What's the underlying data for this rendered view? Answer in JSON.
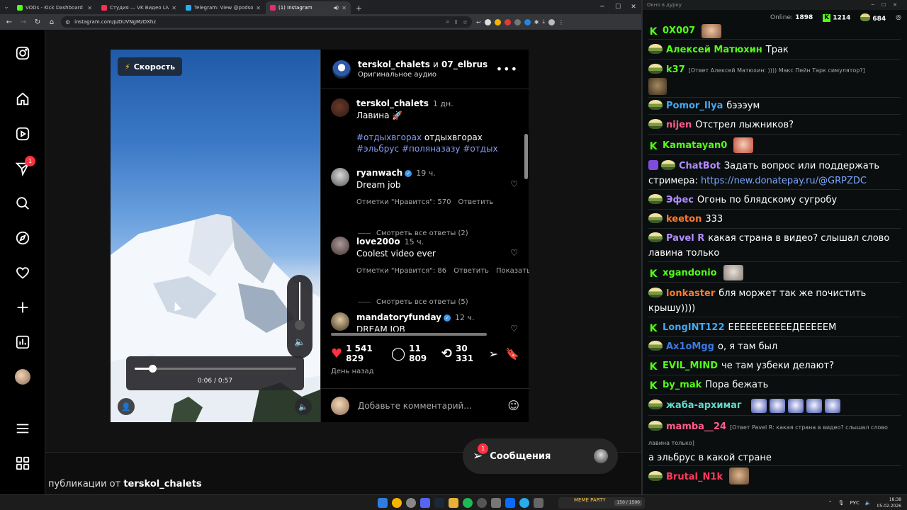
{
  "browser": {
    "tabs": [
      {
        "title": "VODs - Kick Dashboard",
        "color": "#53fc18"
      },
      {
        "title": "Студия — VK Видео Live",
        "color": "#ff2d55"
      },
      {
        "title": "Telegram: View @podsos_club",
        "color": "#2aabee"
      },
      {
        "title": "(1) Instagram",
        "color": "#e1306c"
      }
    ],
    "url": "instagram.com/p/DUVNgMzDXhz"
  },
  "sidebar": {
    "icons": [
      "instagram-logo-icon",
      "home-icon",
      "reels-icon",
      "direct-icon",
      "search-icon",
      "explore-icon",
      "heart-icon",
      "create-icon",
      "dashboard-icon",
      "profile-avatar",
      "menu-icon",
      "apps-icon"
    ],
    "direct_badge": "1"
  },
  "post": {
    "header": {
      "author": "terskol_chalets",
      "joiner": "и",
      "coauthor": "07_elbrus",
      "audio": "Оригинальное аудио"
    },
    "speed_label": "Скорость",
    "video_time": "0:06 / 0:57",
    "video_progress": 0.11,
    "volume_level": 1.0,
    "caption": {
      "user": "terskol_chalets",
      "time": "1 дн.",
      "text": "Лавина 🚀",
      "tag1": "#отдыхвгорах",
      "plain": "отдыхвгорах",
      "tag2": "#эльбрус",
      "tag3": "#поляназазу",
      "tag4": "#отдых"
    },
    "comments": [
      {
        "user": "ryanwach",
        "verified": true,
        "time": "19 ч.",
        "text": "Dream job",
        "likes": "Отметки \"Нравится\": 570",
        "reply": "Ответить",
        "more": "",
        "replies": "Смотреть все ответы (2)"
      },
      {
        "user": "love200o",
        "verified": false,
        "time": "15 ч.",
        "text": "Coolest video ever",
        "likes": "Отметки \"Нравится\": 86",
        "reply": "Ответить",
        "more": "Показать п",
        "replies": "Смотреть все ответы (5)"
      },
      {
        "user": "mandatoryfunday",
        "verified": true,
        "time": "12 ч.",
        "text": "DREAM JOB",
        "likes": "",
        "reply": "",
        "more": "",
        "replies": ""
      }
    ],
    "likes": "1 541 829",
    "comments_count": "11 809",
    "reposts": "30 331",
    "posted": "День назад",
    "add_comment_placeholder": "Добавьте комментарий..."
  },
  "more_from": {
    "prefix": "публикации от",
    "user": "terskol_chalets"
  },
  "messages": {
    "label": "Сообщения",
    "badge": "1"
  },
  "chat": {
    "window_title": "Окно в дурку",
    "online_label": "Online:",
    "online": "1898",
    "kick_count": "1214",
    "other_count": "684",
    "messages": [
      {
        "badge": "k",
        "user": "0X007",
        "color": "#53fc18",
        "text": ""
      },
      {
        "badge": "f",
        "user": "Алексей Матюхин",
        "color": "#53fc18",
        "text": "Трак"
      },
      {
        "badge": "f",
        "user": "k37",
        "color": "#53fc18",
        "reply": "[Ответ Алексей Матюхин: )))) Макс Пейн Тарк симулятор?]",
        "text": ""
      },
      {
        "badge": "f",
        "user": "Pomor_Ilya",
        "color": "#3fa9f5",
        "text": "бэээум"
      },
      {
        "badge": "f",
        "user": "nijen",
        "color": "#ff5c8a",
        "text": "Отстрел лыжников?"
      },
      {
        "badge": "k",
        "user": "Kamatayan0",
        "color": "#53fc18",
        "text": ""
      },
      {
        "badge": "bot",
        "user": "ChatBot",
        "color": "#b18cff",
        "text": "Задать вопрос или поддержать стримера: ",
        "link": "https://new.donatepay.ru/@GRPZDC"
      },
      {
        "badge": "f",
        "user": "Эфес",
        "color": "#b18cff",
        "text": "Огонь по блядскому сугробу"
      },
      {
        "badge": "f",
        "user": "keeton",
        "color": "#ff7a2b",
        "text": "333"
      },
      {
        "badge": "f",
        "user": "Pavel R",
        "color": "#b18cff",
        "text": "какая страна в видео? слышал слово лавина только"
      },
      {
        "badge": "k",
        "user": "xgandonio",
        "color": "#53fc18",
        "text": ""
      },
      {
        "badge": "f",
        "user": "lonkaster",
        "color": "#ff7a2b",
        "text": "бля моржет так же почистить крышу))))"
      },
      {
        "badge": "k",
        "user": "LongINT122",
        "color": "#3fa9f5",
        "text": "ЕЕЕЕЕЕЕЕЕЕЕДЕЕЕЕЕМ"
      },
      {
        "badge": "f",
        "user": "Ax1oMgg",
        "color": "#3f7ae0",
        "text": "о, я там был"
      },
      {
        "badge": "k",
        "user": "EVIL_MIND",
        "color": "#53fc18",
        "text": "че там узбеки делают?"
      },
      {
        "badge": "k",
        "user": "by_mak",
        "color": "#53fc18",
        "text": "Пора бежать"
      },
      {
        "badge": "f",
        "user": "жаба-архимаг",
        "color": "#5fd9c9",
        "text": ""
      },
      {
        "badge": "f",
        "user": "mamba__24",
        "color": "#ff5c8a",
        "reply": "[Ответ Pavel R: какая страна в видео? слышал слово лавина только]",
        "text": "а эльбрус в какой стране"
      },
      {
        "badge": "f",
        "user": "Brutal_N1k",
        "color": "#ff3b5c",
        "text": ""
      }
    ]
  },
  "taskbar": {
    "meme_label": "MEME PARTY",
    "meme_count": "150 / 1500",
    "lang": "РУС",
    "time": "18:38",
    "date": "05.02.2026"
  }
}
